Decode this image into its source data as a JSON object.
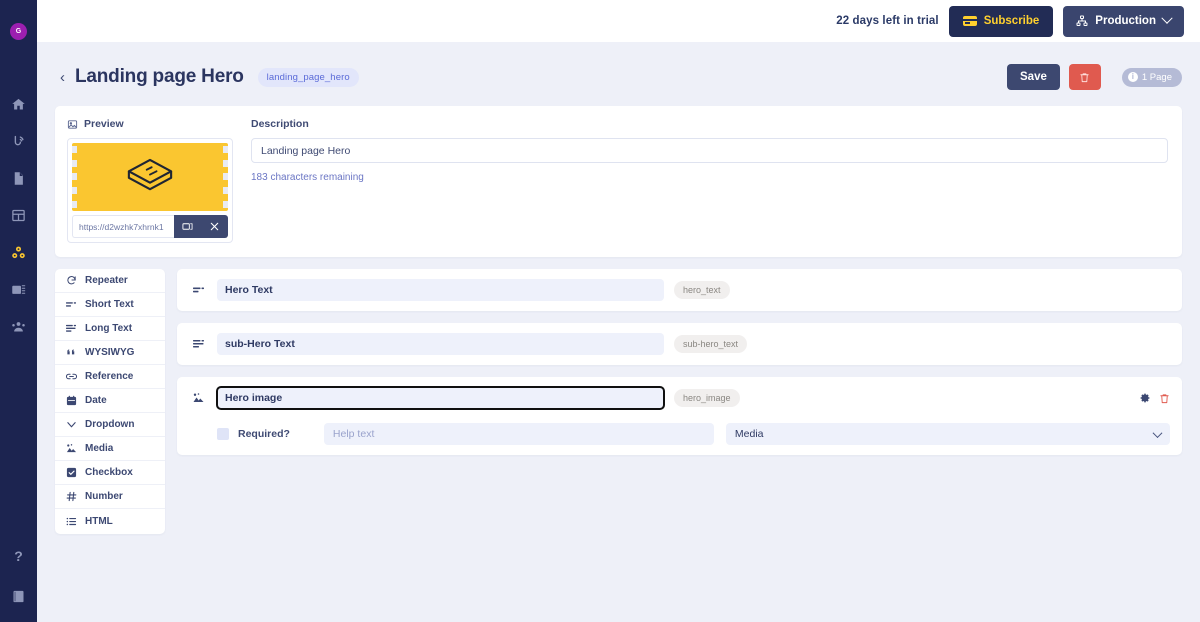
{
  "colors": {
    "rail_bg": "#1c2450",
    "accent_yellow": "#fac630",
    "avatar_purple": "#9c1fb0",
    "danger_red": "#e05a4f",
    "navy": "#222c55",
    "page_bg": "#eef0f8"
  },
  "rail": {
    "avatar_initial": "G",
    "items": [
      {
        "name": "home-icon",
        "label": "Home"
      },
      {
        "name": "broadcast-icon",
        "label": "Broadcast"
      },
      {
        "name": "document-icon",
        "label": "Documents"
      },
      {
        "name": "table-icon",
        "label": "Tables"
      },
      {
        "name": "components-icon",
        "label": "Components",
        "active": true
      },
      {
        "name": "media-icon",
        "label": "Media"
      },
      {
        "name": "users-icon",
        "label": "Users"
      }
    ],
    "help_glyph": "?",
    "book_label": "Docs"
  },
  "topbar": {
    "trial_text": "22 days left in trial",
    "subscribe_label": "Subscribe",
    "environment_label": "Production"
  },
  "header": {
    "back_glyph": "‹",
    "title": "Landing page Hero",
    "slug": "landing_page_hero",
    "save_label": "Save",
    "pages_count_label": "1 Page",
    "info_glyph": "i"
  },
  "preview": {
    "label": "Preview",
    "url": "https://d2wzhk7xhrnk1",
    "expand_title": "Replace image",
    "close_title": "Remove image"
  },
  "description": {
    "label": "Description",
    "value": "Landing page Hero",
    "placeholder": "Description",
    "remaining": "183 characters remaining"
  },
  "field_types": [
    {
      "label": "Repeater",
      "icon": "repeater-icon"
    },
    {
      "label": "Short Text",
      "icon": "short-text-icon"
    },
    {
      "label": "Long Text",
      "icon": "long-text-icon"
    },
    {
      "label": "WYSIWYG",
      "icon": "quote-icon"
    },
    {
      "label": "Reference",
      "icon": "link-icon"
    },
    {
      "label": "Date",
      "icon": "calendar-icon"
    },
    {
      "label": "Dropdown",
      "icon": "chevron-down-icon"
    },
    {
      "label": "Media",
      "icon": "media-icon"
    },
    {
      "label": "Checkbox",
      "icon": "checkbox-icon"
    },
    {
      "label": "Number",
      "icon": "hash-icon"
    },
    {
      "label": "HTML",
      "icon": "html-list-icon"
    }
  ],
  "fields": [
    {
      "name": "Hero Text",
      "slug": "hero_text",
      "icon": "short-text-icon",
      "expanded": false
    },
    {
      "name": "sub-Hero Text",
      "slug": "sub-hero_text",
      "icon": "long-text-icon",
      "expanded": false
    },
    {
      "name": "Hero image",
      "slug": "hero_image",
      "icon": "media-icon",
      "expanded": true,
      "required_label": "Required?",
      "required_checked": false,
      "help_placeholder": "Help text",
      "help_value": "",
      "type_value": "Media"
    }
  ]
}
